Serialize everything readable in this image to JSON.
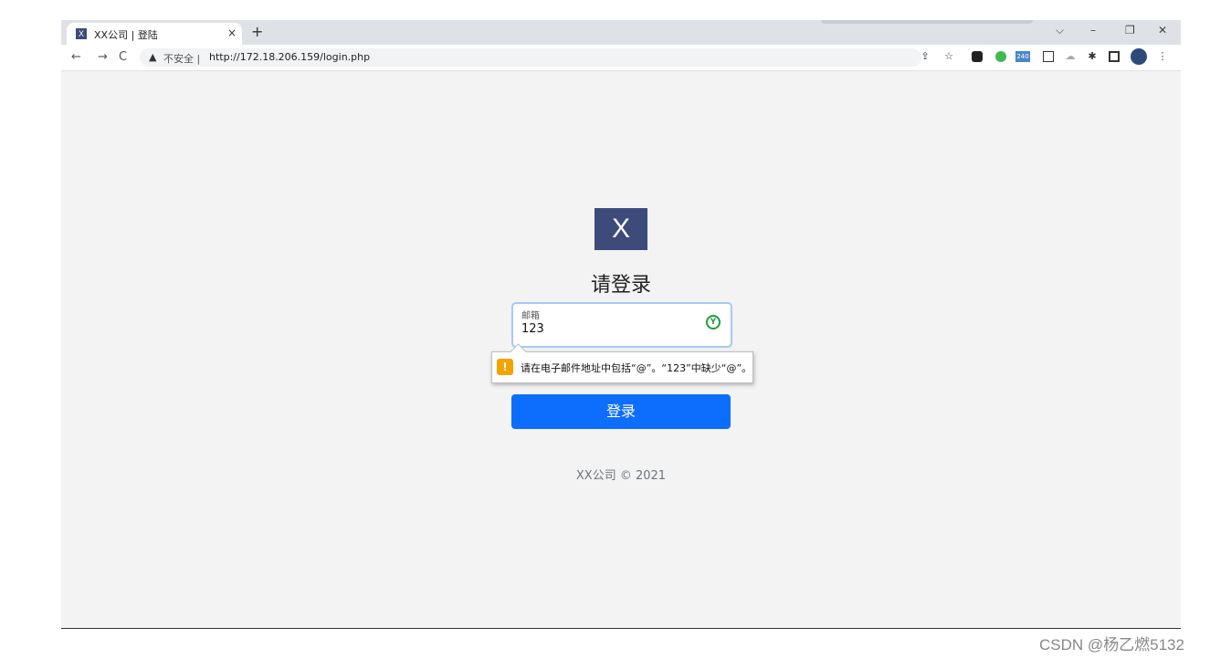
{
  "browser": {
    "tab": {
      "favicon": "X",
      "title": "XX公司 | 登陆",
      "close": "×"
    },
    "new_tab": "+",
    "window_controls": {
      "minimize": "–",
      "restore": "❐",
      "close": "✕",
      "dropdown": "⌵"
    },
    "nav": {
      "back": "←",
      "forward": "→",
      "reload": "C"
    },
    "address": {
      "warning_icon": "▲",
      "security": "不安全 |",
      "url": "http://172.18.206.159/login.php"
    },
    "extensions": {
      "share": "⇪",
      "star": "☆",
      "puzzle": "✱",
      "badge": "240",
      "menu": "⋮"
    }
  },
  "page": {
    "logo": "X",
    "heading": "请登录",
    "email": {
      "label": "邮箱",
      "value": "123"
    },
    "validation": {
      "icon": "!",
      "message": "请在电子邮件地址中包括“@”。“123”中缺少“@”。"
    },
    "login_button": "登录",
    "footer": "XX公司 © 2021"
  },
  "watermark": "CSDN @杨乙燃5132"
}
